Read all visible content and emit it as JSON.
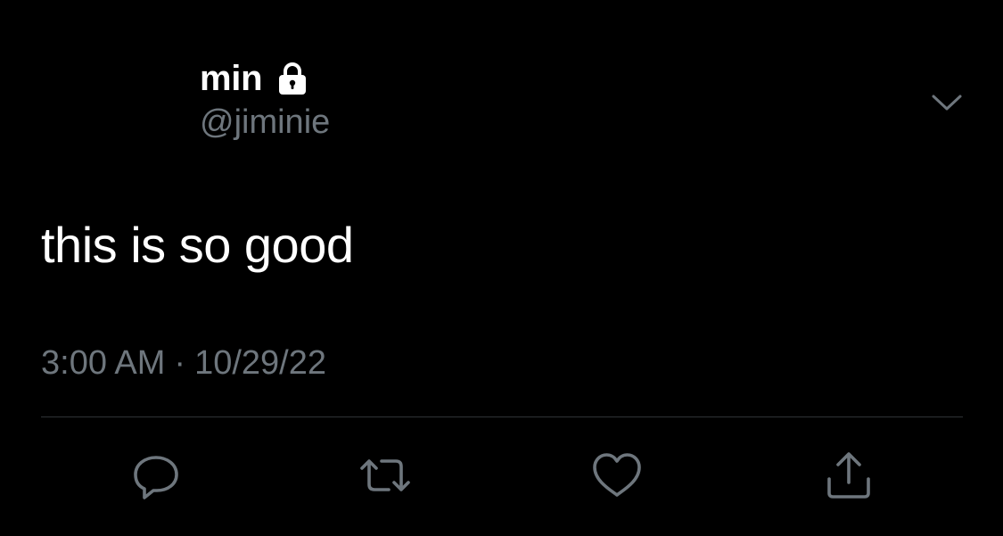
{
  "tweet": {
    "author": {
      "display_name": "min",
      "handle": "@jiminie",
      "protected_icon": "lock-icon"
    },
    "menu_icon": "chevron-down-icon",
    "text": "this is so good",
    "time": "3:00 AM",
    "separator": "·",
    "date": "10/29/22"
  },
  "actions": {
    "reply_icon": "reply-icon",
    "retweet_icon": "retweet-icon",
    "like_icon": "heart-icon",
    "share_icon": "share-icon"
  },
  "colors": {
    "background": "#000000",
    "primary_text": "#ffffff",
    "secondary_text": "#6e767d",
    "divider": "#2f3336",
    "icon": "#6e767d"
  }
}
